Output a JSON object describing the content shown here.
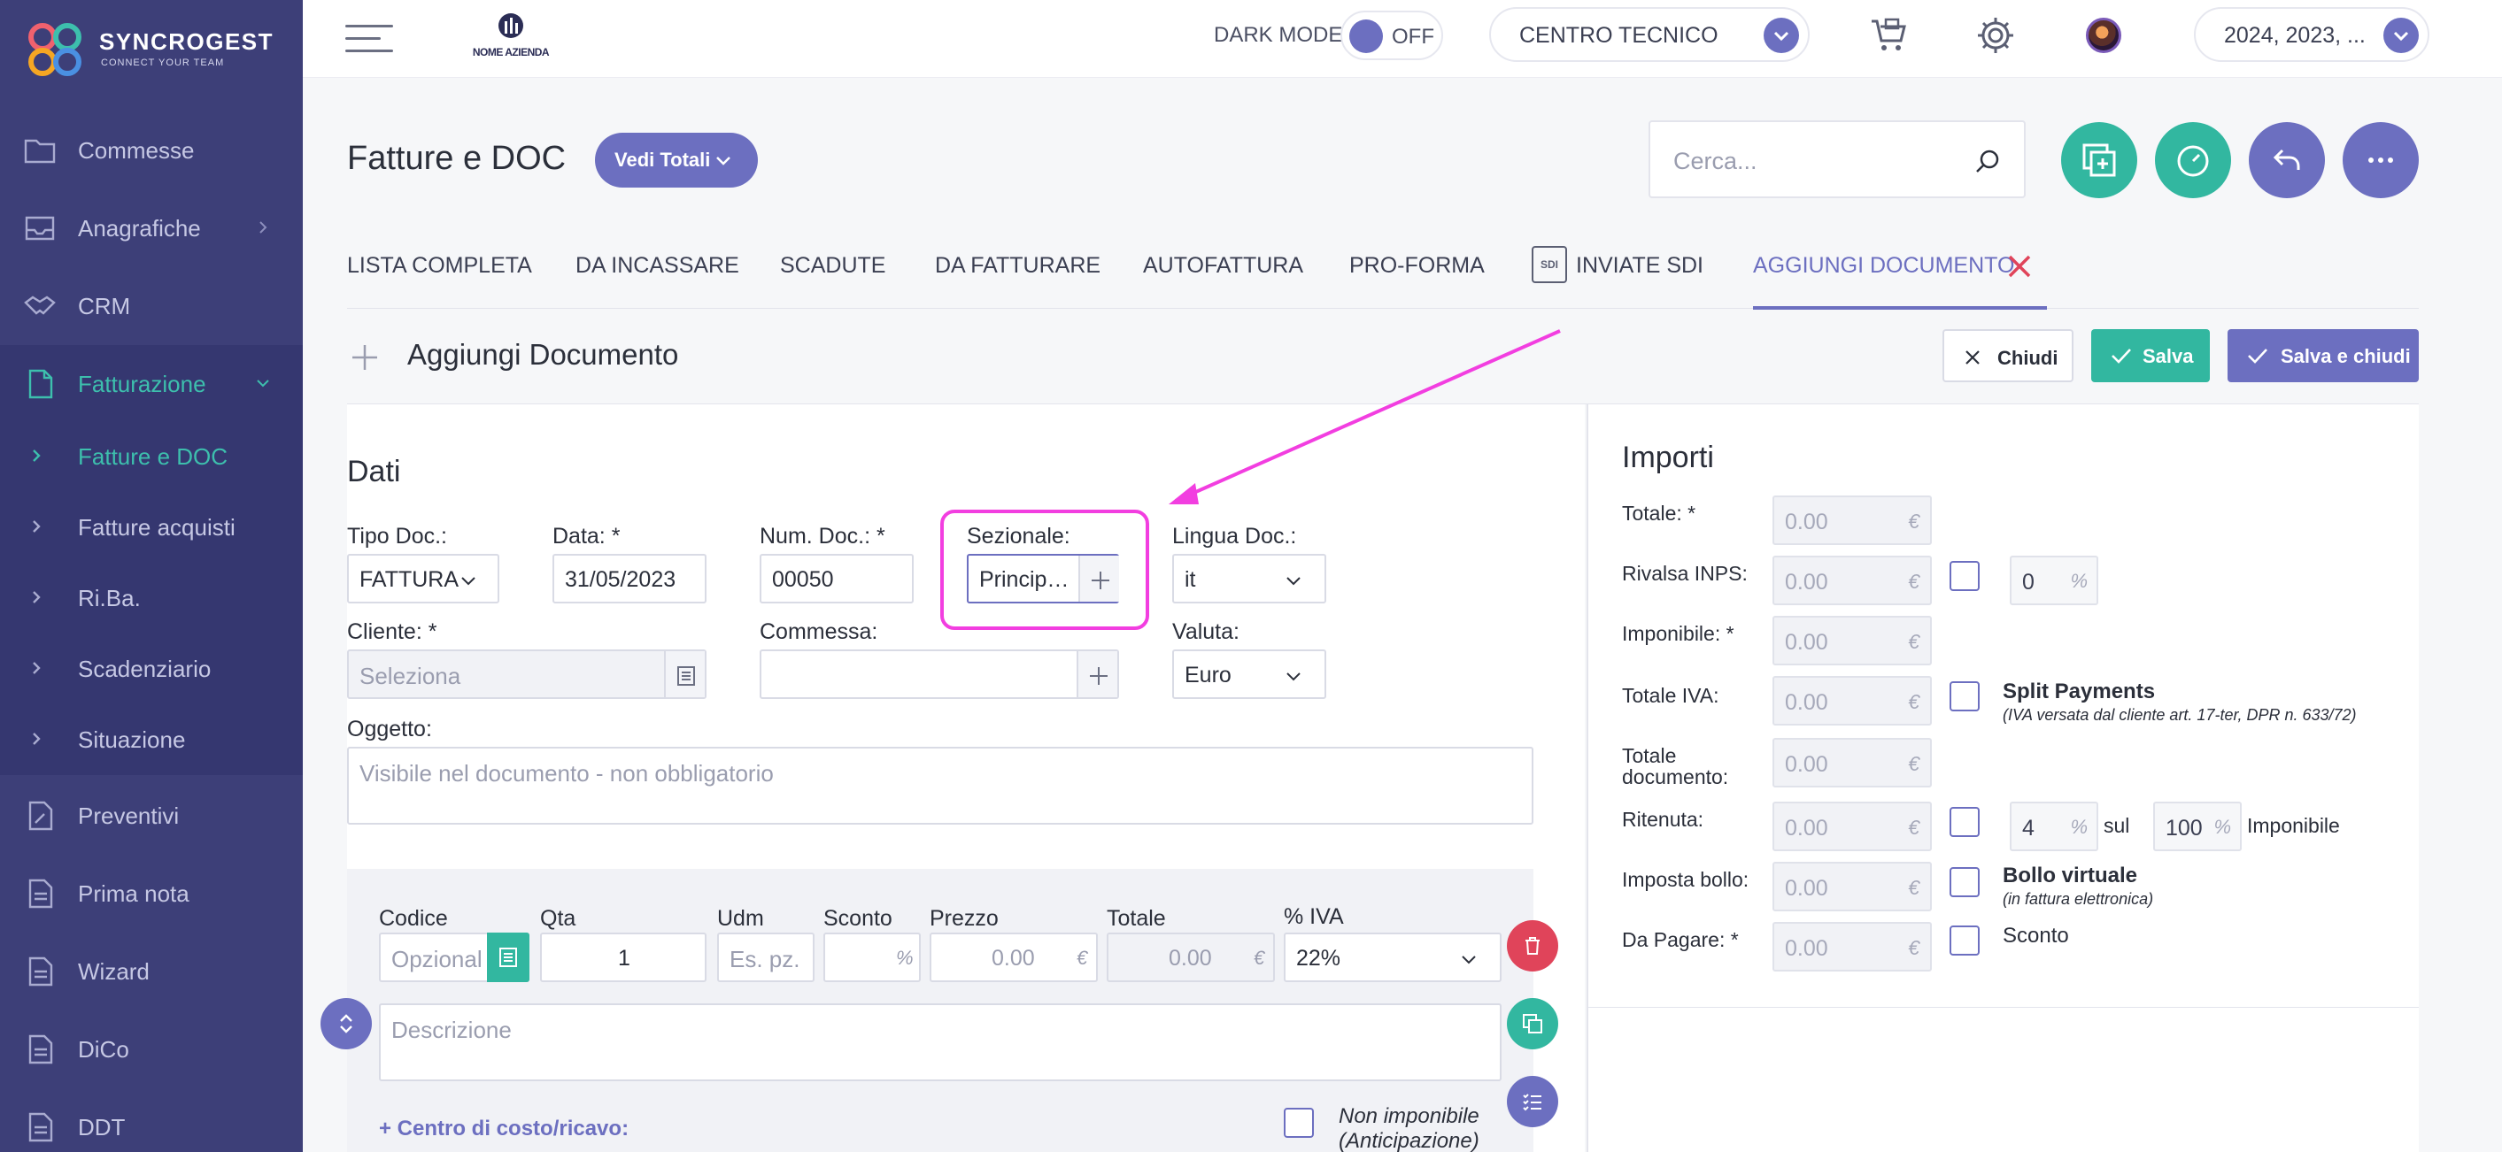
{
  "brand": {
    "name": "SYNCROGEST",
    "tagline": "CONNECT YOUR TEAM"
  },
  "sidebar": {
    "items": [
      {
        "label": "Commesse",
        "icon": "folder-icon"
      },
      {
        "label": "Anagrafiche",
        "icon": "inbox-icon"
      },
      {
        "label": "CRM",
        "icon": "handshake-icon"
      },
      {
        "label": "Fatturazione",
        "icon": "document-icon"
      },
      {
        "label": "Preventivi",
        "icon": "document-edit-icon"
      },
      {
        "label": "Prima nota",
        "icon": "document-list-icon"
      },
      {
        "label": "Wizard",
        "icon": "document-list-icon"
      },
      {
        "label": "DiCo",
        "icon": "document-list-icon"
      },
      {
        "label": "DDT",
        "icon": "document-list-icon"
      }
    ],
    "subitems": [
      {
        "label": "Fatture e DOC"
      },
      {
        "label": "Fatture acquisti"
      },
      {
        "label": "Ri.Ba."
      },
      {
        "label": "Scadenziario"
      },
      {
        "label": "Situazione"
      }
    ]
  },
  "topbar": {
    "company_logo_text": "NOME AZIENDA",
    "dark_mode_label": "DARK MODE",
    "dark_mode_state": "OFF",
    "centro_select": "CENTRO TECNICO",
    "years_select": "2024, 2023, ..."
  },
  "page": {
    "title": "Fatture e DOC",
    "totali_button": "Vedi Totali",
    "search_placeholder": "Cerca..."
  },
  "tabs": [
    {
      "label": "LISTA COMPLETA"
    },
    {
      "label": "DA INCASSARE"
    },
    {
      "label": "SCADUTE"
    },
    {
      "label": "DA FATTURARE"
    },
    {
      "label": "AUTOFATTURA"
    },
    {
      "label": "PRO-FORMA"
    },
    {
      "label": "INVIATE SDI",
      "icon_text": "SDI"
    },
    {
      "label": "AGGIUNGI DOCUMENTO"
    }
  ],
  "section": {
    "title": "Aggiungi Documento",
    "close_label": "Chiudi",
    "save_label": "Salva",
    "save_close_label": "Salva e chiudi"
  },
  "dati": {
    "title": "Dati",
    "tipo_doc": {
      "label": "Tipo Doc.:",
      "value": "FATTURA"
    },
    "data": {
      "label": "Data: *",
      "value": "31/05/2023"
    },
    "num_doc": {
      "label": "Num. Doc.: *",
      "value": "00050"
    },
    "sezionale": {
      "label": "Sezionale:",
      "value": "Princip…"
    },
    "lingua": {
      "label": "Lingua Doc.:",
      "value": "it"
    },
    "cliente": {
      "label": "Cliente: *",
      "placeholder": "Seleziona"
    },
    "commessa": {
      "label": "Commessa:",
      "value": ""
    },
    "valuta": {
      "label": "Valuta:",
      "value": "Euro"
    },
    "oggetto": {
      "label": "Oggetto:",
      "placeholder": "Visibile nel documento - non obbligatorio"
    }
  },
  "row": {
    "codice": {
      "label": "Codice",
      "placeholder": "Opzional"
    },
    "qta": {
      "label": "Qta",
      "value": "1"
    },
    "udm": {
      "label": "Udm",
      "placeholder": "Es. pz."
    },
    "sconto": {
      "label": "Sconto",
      "unit": "%"
    },
    "prezzo": {
      "label": "Prezzo",
      "value": "0.00",
      "unit": "€"
    },
    "totale": {
      "label": "Totale",
      "value": "0.00",
      "unit": "€"
    },
    "iva": {
      "label": "% IVA",
      "value": "22%"
    },
    "descrizione_placeholder": "Descrizione",
    "centro_link": "+ Centro di costo/ricavo:",
    "non_imponibile_line1": "Non imponibile",
    "non_imponibile_line2": "(Anticipazione)"
  },
  "importi": {
    "title": "Importi",
    "totale": {
      "label": "Totale: *",
      "value": "0.00",
      "unit": "€"
    },
    "rivalsa": {
      "label": "Rivalsa INPS:",
      "value": "0.00",
      "unit": "€",
      "pct": "0",
      "pct_unit": "%"
    },
    "imponibile": {
      "label": "Imponibile: *",
      "value": "0.00",
      "unit": "€"
    },
    "totale_iva": {
      "label": "Totale IVA:",
      "value": "0.00",
      "unit": "€",
      "split_label": "Split Payments",
      "split_note": "(IVA versata dal cliente art. 17-ter, DPR n. 633/72)"
    },
    "totale_documento": {
      "label_line1": "Totale",
      "label_line2": "documento:",
      "value": "0.00",
      "unit": "€"
    },
    "ritenuta": {
      "label": "Ritenuta:",
      "value": "0.00",
      "unit": "€",
      "pct": "4",
      "pct_unit": "%",
      "sul": "sul",
      "base": "100",
      "base_unit": "%",
      "imponibile_label": "Imponibile"
    },
    "bollo": {
      "label": "Imposta bollo:",
      "value": "0.00",
      "unit": "€",
      "virtuale_label": "Bollo virtuale",
      "virtuale_note": "(in fattura elettronica)"
    },
    "da_pagare": {
      "label": "Da Pagare: *",
      "value": "0.00",
      "unit": "€",
      "sconto_label": "Sconto"
    }
  },
  "colors": {
    "sidebar_bg": "#3d3f78",
    "accent_purple": "#6c6fc0",
    "accent_teal": "#32b7a0",
    "danger_red": "#e0445a",
    "highlight_magenta": "#f23ee0"
  }
}
